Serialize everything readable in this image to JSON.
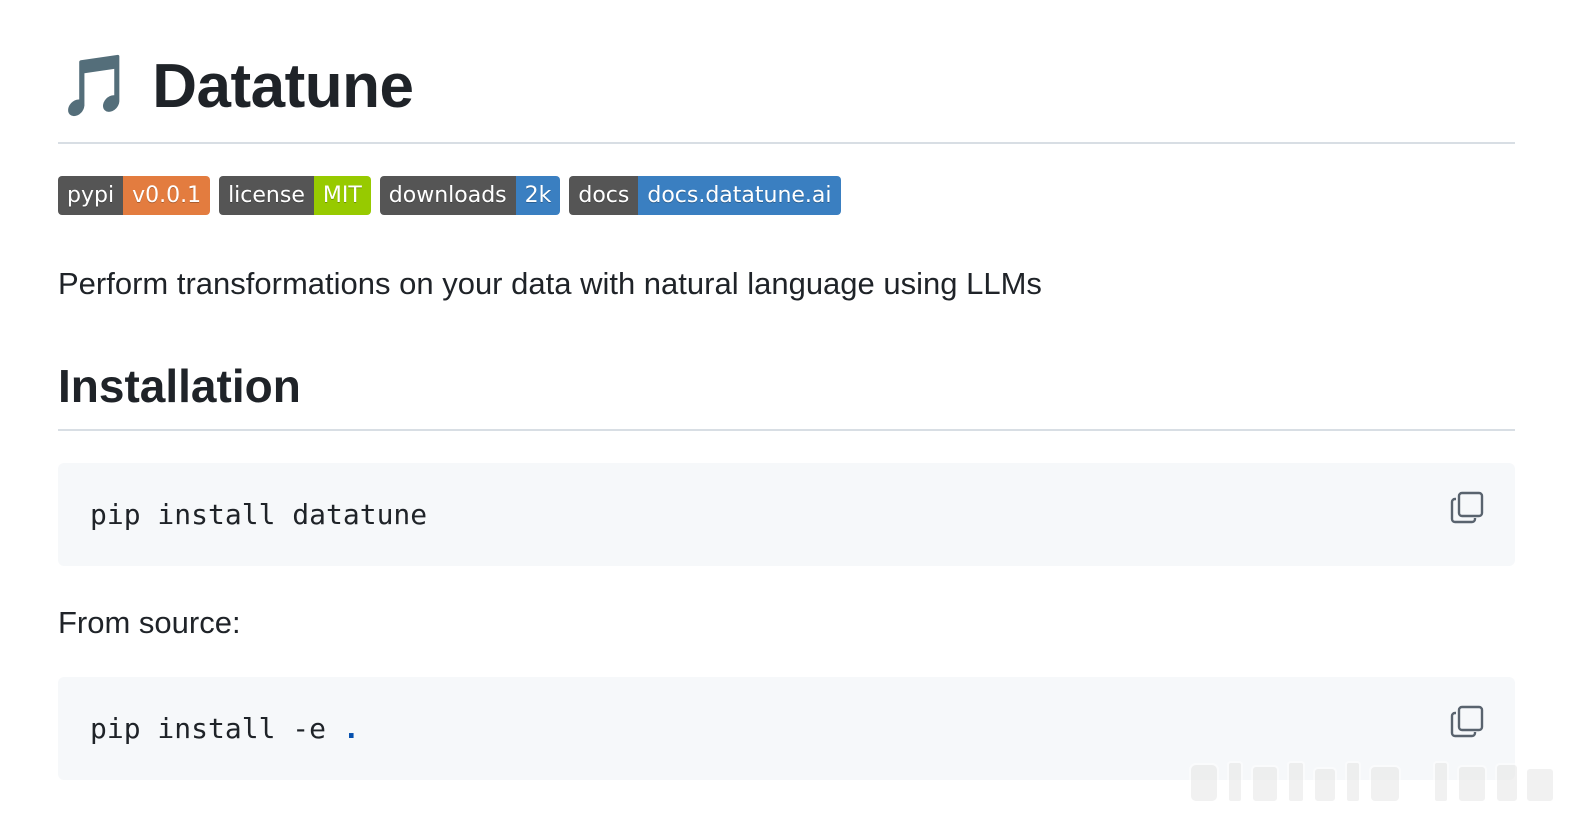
{
  "header": {
    "emoji": "🎵",
    "title": "Datatune"
  },
  "badges": [
    {
      "label": "pypi",
      "value": "v0.0.1",
      "color": "#e05d44",
      "value_bg": "#e37c3f"
    },
    {
      "label": "license",
      "value": "MIT",
      "color": "#97ca00",
      "value_bg": "#97ca00"
    },
    {
      "label": "downloads",
      "value": "2k",
      "value_bg": "#3a7fc1"
    },
    {
      "label": "docs",
      "value": "docs.datatune.ai",
      "value_bg": "#3a7fc1"
    }
  ],
  "description": "Perform transformations on your data with natural language using LLMs",
  "installation": {
    "heading": "Installation",
    "code1": "pip install datatune",
    "from_source_label": "From source:",
    "code2_cmd": "pip install -e ",
    "code2_dot": "."
  },
  "icons": {
    "copy": "copy-icon",
    "watermark": "watermark-logo"
  }
}
